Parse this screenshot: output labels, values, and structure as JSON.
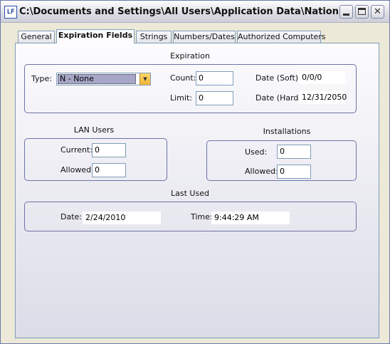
{
  "window": {
    "title": "C:\\Documents and Settings\\All Users\\Application Data\\National Instru...",
    "app_icon": "LF",
    "close_symbol": "✕",
    "accent_color": "#6e73a6"
  },
  "tabs": [
    {
      "label": "General",
      "active": false
    },
    {
      "label": "Expiration Fields",
      "active": true
    },
    {
      "label": "Strings",
      "active": false
    },
    {
      "label": "Numbers/Dates",
      "active": false
    },
    {
      "label": "Authorized Computers",
      "active": false
    }
  ],
  "expiration": {
    "caption": "Expiration",
    "type_label": "Type:",
    "type_value": "N - None",
    "count_label": "Count:",
    "count_value": "0",
    "limit_label": "Limit:",
    "limit_value": "0",
    "date_soft_label": "Date (Soft):",
    "date_soft_value": "0/0/0",
    "date_hard_label": "Date (Hard):",
    "date_hard_value": "12/31/2050"
  },
  "lan_users": {
    "caption": "LAN Users",
    "current_label": "Current:",
    "current_value": "0",
    "allowed_label": "Allowed:",
    "allowed_value": "0"
  },
  "installations": {
    "caption": "Installations",
    "used_label": "Used:",
    "used_value": "0",
    "allowed_label": "Allowed:",
    "allowed_value": "0"
  },
  "last_used": {
    "caption": "Last Used",
    "date_label": "Date:",
    "date_value": "2/24/2010",
    "time_label": "Time:",
    "time_value": "9:44:29 AM"
  }
}
